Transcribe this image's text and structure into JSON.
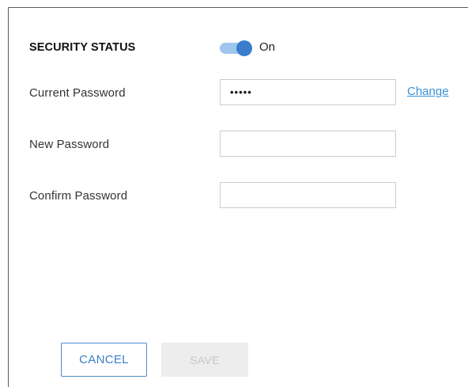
{
  "security": {
    "status_label": "SECURITY STATUS",
    "toggle_state": "On",
    "toggle_on": true,
    "toggle_track_color": "#9ec6ee",
    "toggle_knob_color": "#3a7dcc"
  },
  "fields": {
    "current_password": {
      "label": "Current Password",
      "value": "•••••"
    },
    "change_link": "Change",
    "new_password": {
      "label": "New Password",
      "value": ""
    },
    "confirm_password": {
      "label": "Confirm Password",
      "value": ""
    }
  },
  "actions": {
    "cancel_label": "CANCEL",
    "save_label": "SAVE",
    "save_enabled": false,
    "accent_color": "#3a7ec6"
  }
}
